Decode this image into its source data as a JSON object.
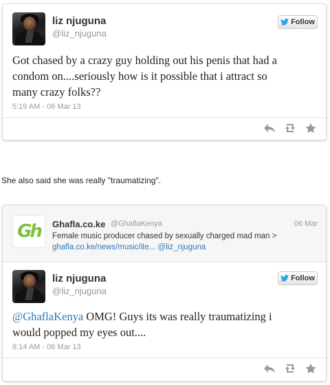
{
  "tweet1": {
    "name": "liz njuguna",
    "handle": "@liz_njuguna",
    "follow_label": "Follow",
    "text_line1": "Got chased by a crazy guy holding out his penis that had a",
    "text_line2": "condom on....seriously how is it possible that i attract so",
    "text_line3": "many crazy folks??",
    "timestamp": "5:19 AM - 06 Mar 13"
  },
  "caption": "She also said she was really \"traumatizing\".",
  "quoted": {
    "logo_text": "Gh",
    "name": "Ghafla.co.ke",
    "handle": "@GhaflaKenya",
    "date": "06 Mar",
    "text_line1": "Female music producer chased by sexually charged mad man >",
    "link": "ghafla.co.ke/news/music/ite...",
    "mention": "@liz_njuguna"
  },
  "tweet2": {
    "name": "liz njuguna",
    "handle": "@liz_njuguna",
    "follow_label": "Follow",
    "mention": "@GhaflaKenya",
    "text_line1_rest": " OMG! Guys its was really traumatizing i",
    "text_line2": "would popped my eyes out....",
    "timestamp": "8:14 AM - 06 Mar 13"
  },
  "colors": {
    "link": "#2a77b6",
    "logo_green": "#7fbf3a",
    "twitter_blue": "#2aa9e0"
  },
  "icons": [
    "twitter-bird-icon",
    "reply-icon",
    "retweet-icon",
    "favorite-icon"
  ]
}
